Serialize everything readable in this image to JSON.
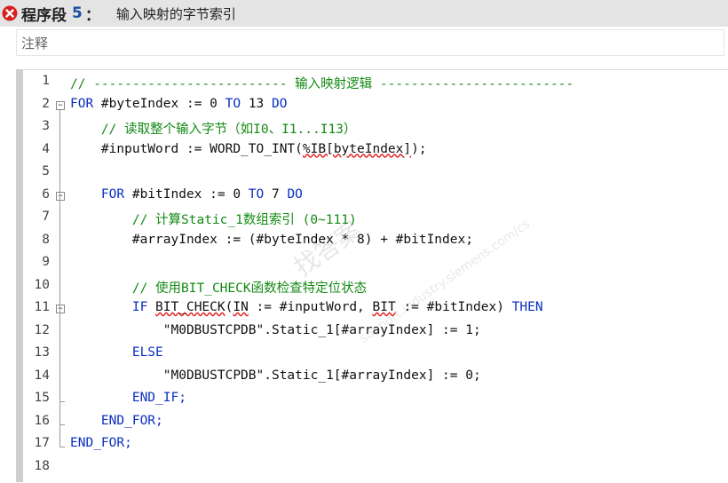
{
  "header": {
    "title": "程序段",
    "number": "5",
    "colon": "：",
    "name": "输入映射的字节索引"
  },
  "comment": {
    "label": "注释"
  },
  "watermark": {
    "text": "找答案",
    "url": "support.industry.siemens.com/cs"
  },
  "code": {
    "lines": [
      {
        "n": "1",
        "tokens": [
          {
            "t": "// ------------------------- 输入映射逻辑 -------------------------",
            "c": "cm"
          }
        ]
      },
      {
        "n": "2",
        "tokens": [
          {
            "t": "FOR",
            "c": "kw"
          },
          {
            "t": " #byteIndex := ",
            "c": "id"
          },
          {
            "t": "0",
            "c": "num"
          },
          {
            "t": " TO ",
            "c": "kw"
          },
          {
            "t": "13",
            "c": "num"
          },
          {
            "t": " DO",
            "c": "kw"
          }
        ]
      },
      {
        "n": "3",
        "tokens": [
          {
            "t": "    // 读取整个输入字节（如I0、I1...I13）",
            "c": "cm"
          }
        ]
      },
      {
        "n": "4",
        "tokens": [
          {
            "t": "    #inputWord := WORD_TO_INT(",
            "c": "id"
          },
          {
            "t": "%IB[byteIndex]",
            "c": "sq"
          },
          {
            "t": ");",
            "c": "id"
          }
        ]
      },
      {
        "n": "5",
        "tokens": []
      },
      {
        "n": "6",
        "tokens": [
          {
            "t": "    FOR",
            "c": "kw"
          },
          {
            "t": " #bitIndex := ",
            "c": "id"
          },
          {
            "t": "0",
            "c": "num"
          },
          {
            "t": " TO ",
            "c": "kw"
          },
          {
            "t": "7",
            "c": "num"
          },
          {
            "t": " DO",
            "c": "kw"
          }
        ]
      },
      {
        "n": "7",
        "tokens": [
          {
            "t": "        // 计算Static_1数组索引 (0~111)",
            "c": "cm"
          }
        ]
      },
      {
        "n": "8",
        "tokens": [
          {
            "t": "        #arrayIndex := (#byteIndex * 8) + #bitIndex;",
            "c": "id"
          }
        ]
      },
      {
        "n": "9",
        "tokens": []
      },
      {
        "n": "10",
        "tokens": [
          {
            "t": "        // 使用BIT_CHECK函数检查特定位状态",
            "c": "cm"
          }
        ]
      },
      {
        "n": "11",
        "tokens": [
          {
            "t": "        IF",
            "c": "kw"
          },
          {
            "t": " ",
            "c": "id"
          },
          {
            "t": "BIT_CHECK",
            "c": "sq"
          },
          {
            "t": "(",
            "c": "id"
          },
          {
            "t": "IN",
            "c": "sq"
          },
          {
            "t": " := #inputWord, ",
            "c": "id"
          },
          {
            "t": "BIT",
            "c": "sq"
          },
          {
            "t": " := #bitIndex) ",
            "c": "id"
          },
          {
            "t": "THEN",
            "c": "kw"
          }
        ]
      },
      {
        "n": "12",
        "tokens": [
          {
            "t": "            \"M0DBUSTCPDB\".Static_1[#arrayIndex] := ",
            "c": "id"
          },
          {
            "t": "1",
            "c": "num"
          },
          {
            "t": ";",
            "c": "id"
          }
        ]
      },
      {
        "n": "13",
        "tokens": [
          {
            "t": "        ELSE",
            "c": "kw"
          }
        ]
      },
      {
        "n": "14",
        "tokens": [
          {
            "t": "            \"M0DBUSTCPDB\".Static_1[#arrayIndex] := ",
            "c": "id"
          },
          {
            "t": "0",
            "c": "num"
          },
          {
            "t": ";",
            "c": "id"
          }
        ]
      },
      {
        "n": "15",
        "tokens": [
          {
            "t": "        END_IF;",
            "c": "kw"
          }
        ]
      },
      {
        "n": "16",
        "tokens": [
          {
            "t": "    END_FOR;",
            "c": "kw"
          }
        ]
      },
      {
        "n": "17",
        "tokens": [
          {
            "t": "END_FOR;",
            "c": "kw"
          }
        ]
      },
      {
        "n": "18",
        "tokens": []
      }
    ],
    "folds": [
      "2",
      "6",
      "11"
    ]
  }
}
